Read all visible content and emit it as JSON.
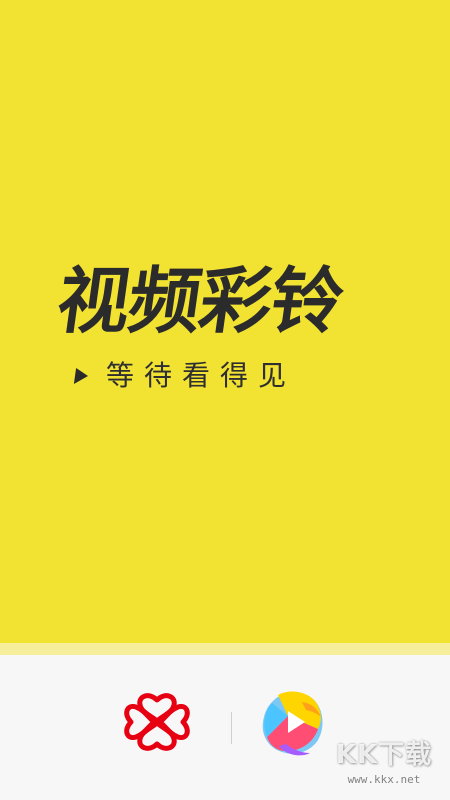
{
  "splash": {
    "title": "视频彩铃",
    "slogan": "等待看得见",
    "play_icon": "play-icon"
  },
  "brand_bar": {
    "carrier_logo_icon": "china-unicom-logo-icon",
    "app_logo_icon": "video-ringtone-app-logo-icon"
  },
  "watermark": {
    "main": "KK下载",
    "url": "www.kkx.net"
  },
  "colors": {
    "hero_background": "#f2e232",
    "title_text": "#2b2b2b",
    "carrier_red": "#e60012",
    "bottom_background": "#f7f7f7"
  }
}
